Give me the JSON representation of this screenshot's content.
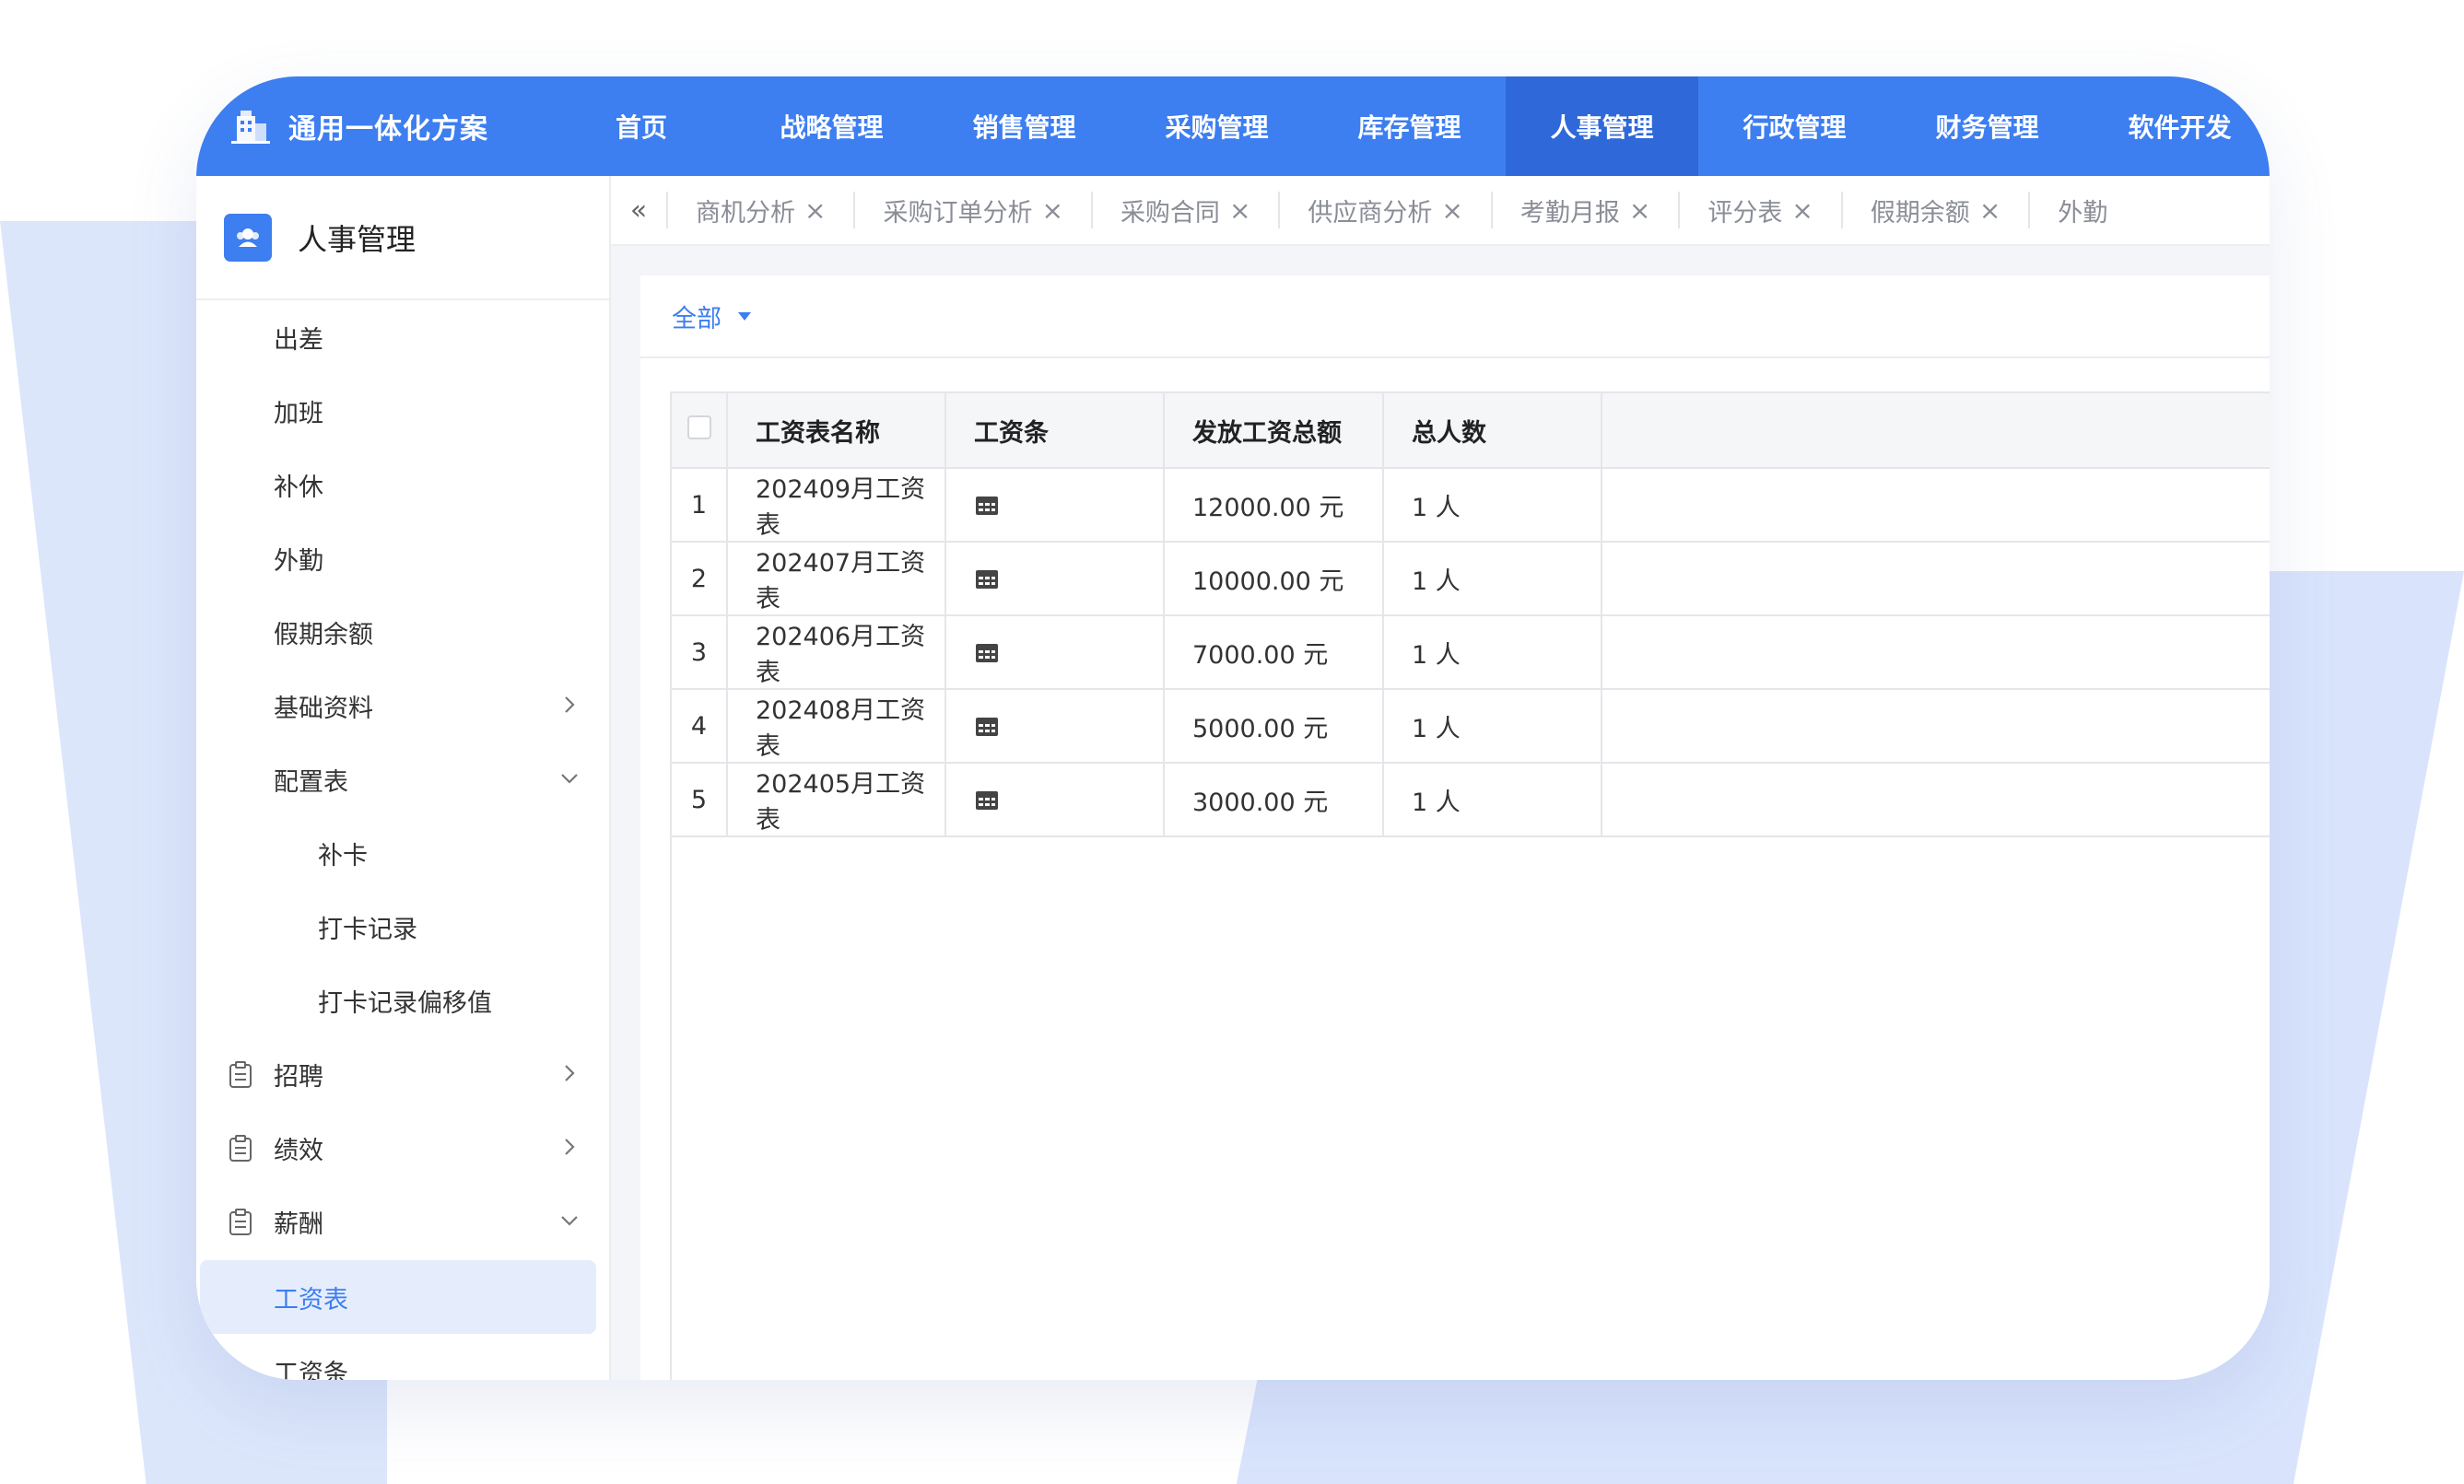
{
  "app": {
    "title": "通用一体化方案"
  },
  "nav": [
    "首页",
    "战略管理",
    "销售管理",
    "采购管理",
    "库存管理",
    "人事管理",
    "行政管理",
    "财务管理",
    "软件开发"
  ],
  "nav_active_index": 5,
  "sidebar": {
    "title": "人事管理",
    "items": [
      {
        "label": "出差"
      },
      {
        "label": "加班"
      },
      {
        "label": "补休"
      },
      {
        "label": "外勤"
      },
      {
        "label": "假期余额"
      },
      {
        "label": "基础资料"
      },
      {
        "label": "配置表"
      },
      {
        "label": "补卡"
      },
      {
        "label": "打卡记录"
      },
      {
        "label": "打卡记录偏移值"
      },
      {
        "label": "招聘"
      },
      {
        "label": "绩效"
      },
      {
        "label": "薪酬"
      },
      {
        "label": "工资表"
      },
      {
        "label": "工资条"
      }
    ]
  },
  "tabs": [
    "商机分析",
    "采购订单分析",
    "采购合同",
    "供应商分析",
    "考勤月报",
    "评分表",
    "假期余额",
    "外勤"
  ],
  "tabs_collapse": "«",
  "tab_close": "×",
  "filter": {
    "label": "全部"
  },
  "table": {
    "columns": [
      "工资表名称",
      "工资条",
      "发放工资总额",
      "总人数"
    ],
    "rows": [
      {
        "idx": "1",
        "name": "202409月工资表",
        "total": "12000.00 元",
        "count": "1 人"
      },
      {
        "idx": "2",
        "name": "202407月工资表",
        "total": "10000.00 元",
        "count": "1 人"
      },
      {
        "idx": "3",
        "name": "202406月工资表",
        "total": "7000.00 元",
        "count": "1 人"
      },
      {
        "idx": "4",
        "name": "202408月工资表",
        "total": "5000.00 元",
        "count": "1 人"
      },
      {
        "idx": "5",
        "name": "202405月工资表",
        "total": "3000.00 元",
        "count": "1 人"
      }
    ]
  },
  "colors": {
    "accent": "#3d7ef0",
    "nav_active": "#2f68d8",
    "bg_shape": "#dce6fb"
  }
}
